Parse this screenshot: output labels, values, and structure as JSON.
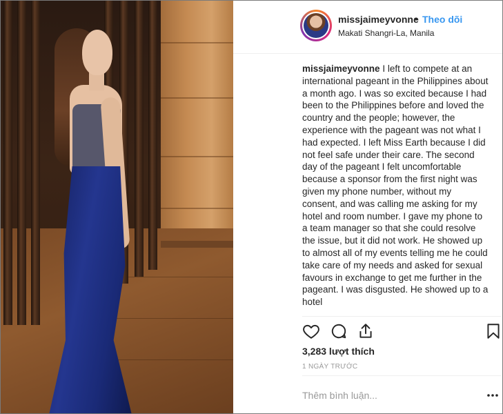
{
  "post": {
    "username": "missjaimeyvonne",
    "separator": "•",
    "follow_label": "Theo dõi",
    "location": "Makati Shangri-La, Manila"
  },
  "caption": {
    "username": "missjaimeyvonne",
    "text": "I left to compete at an international pageant in the Philippines about a month ago. I was so excited because I had been to the Philippines before and loved the country and the people; however, the experience with the pageant was not what I had expected. I left Miss Earth because I did not feel safe under their care. The second day of the pageant I felt uncomfortable because a sponsor from the first night was given my phone number, without my consent, and was calling me asking for my hotel and room number. I gave my phone to a team manager so that she could resolve the issue, but it did not work. He showed up to almost all of my events telling me he could take care of my needs and asked for sexual favours in exchange to get me further in the pageant. I was disgusted. He showed up to a hotel"
  },
  "actions": {
    "like_icon": "heart-icon",
    "comment_icon": "comment-icon",
    "share_icon": "share-icon",
    "save_icon": "bookmark-icon"
  },
  "likes_label": "3,283 lượt thích",
  "timestamp": "1 NGÀY TRƯỚC",
  "comment_placeholder": "Thêm bình luận...",
  "colors": {
    "link": "#3897f0",
    "text": "#262626",
    "muted": "#999999"
  }
}
